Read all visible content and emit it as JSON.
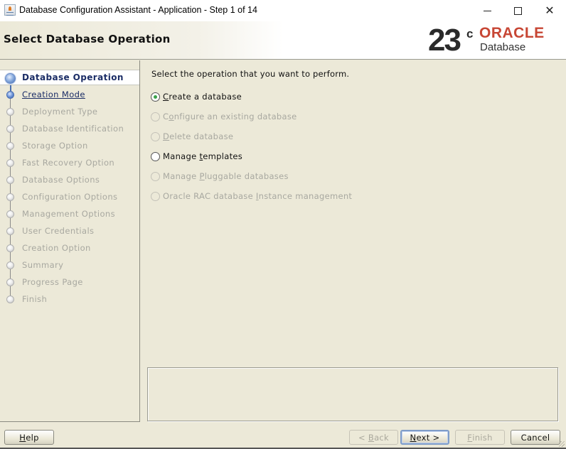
{
  "window": {
    "title": "Database Configuration Assistant - Application - Step 1 of 14",
    "controls": {
      "minimize": "minimize-icon",
      "maximize": "maximize-icon",
      "close": "close-icon",
      "close_glyph": "✕"
    }
  },
  "header": {
    "title": "Select Database Operation",
    "logo": {
      "version": "23",
      "suffix": "c",
      "brand": "ORACLE",
      "product": "Database",
      "brand_color": "#c74634"
    }
  },
  "steps": [
    {
      "label": "Database Operation",
      "state": "current"
    },
    {
      "label": "Creation Mode",
      "state": "next"
    },
    {
      "label": "Deployment Type",
      "state": "disabled"
    },
    {
      "label": "Database Identification",
      "state": "disabled"
    },
    {
      "label": "Storage Option",
      "state": "disabled"
    },
    {
      "label": "Fast Recovery Option",
      "state": "disabled"
    },
    {
      "label": "Database Options",
      "state": "disabled"
    },
    {
      "label": "Configuration Options",
      "state": "disabled"
    },
    {
      "label": "Management Options",
      "state": "disabled"
    },
    {
      "label": "User Credentials",
      "state": "disabled"
    },
    {
      "label": "Creation Option",
      "state": "disabled"
    },
    {
      "label": "Summary",
      "state": "disabled"
    },
    {
      "label": "Progress Page",
      "state": "disabled"
    },
    {
      "label": "Finish",
      "state": "disabled"
    }
  ],
  "main": {
    "prompt": "Select the operation that you want to perform.",
    "options": [
      {
        "pre": "",
        "mnemonic": "C",
        "post": "reate a database",
        "checked": true,
        "enabled": true
      },
      {
        "pre": "C",
        "mnemonic": "o",
        "post": "nfigure an existing database",
        "checked": false,
        "enabled": false
      },
      {
        "pre": "",
        "mnemonic": "D",
        "post": "elete database",
        "checked": false,
        "enabled": false
      },
      {
        "pre": "Manage ",
        "mnemonic": "t",
        "post": "emplates",
        "checked": false,
        "enabled": true
      },
      {
        "pre": "Manage ",
        "mnemonic": "P",
        "post": "luggable databases",
        "checked": false,
        "enabled": false
      },
      {
        "pre": "Oracle RAC database ",
        "mnemonic": "I",
        "post": "nstance management",
        "checked": false,
        "enabled": false
      }
    ],
    "message": ""
  },
  "buttons": {
    "help": {
      "mnemonic": "H",
      "rest": "elp"
    },
    "back": {
      "pre": "< ",
      "mnemonic": "B",
      "rest": "ack"
    },
    "next": {
      "mnemonic": "N",
      "rest": "ext >"
    },
    "finish": {
      "mnemonic": "F",
      "rest": "inish"
    },
    "cancel": {
      "label": "Cancel"
    }
  },
  "colors": {
    "accent": "#1b2d66",
    "selected_radio": "#3aa24a",
    "background": "#ece9d8"
  }
}
